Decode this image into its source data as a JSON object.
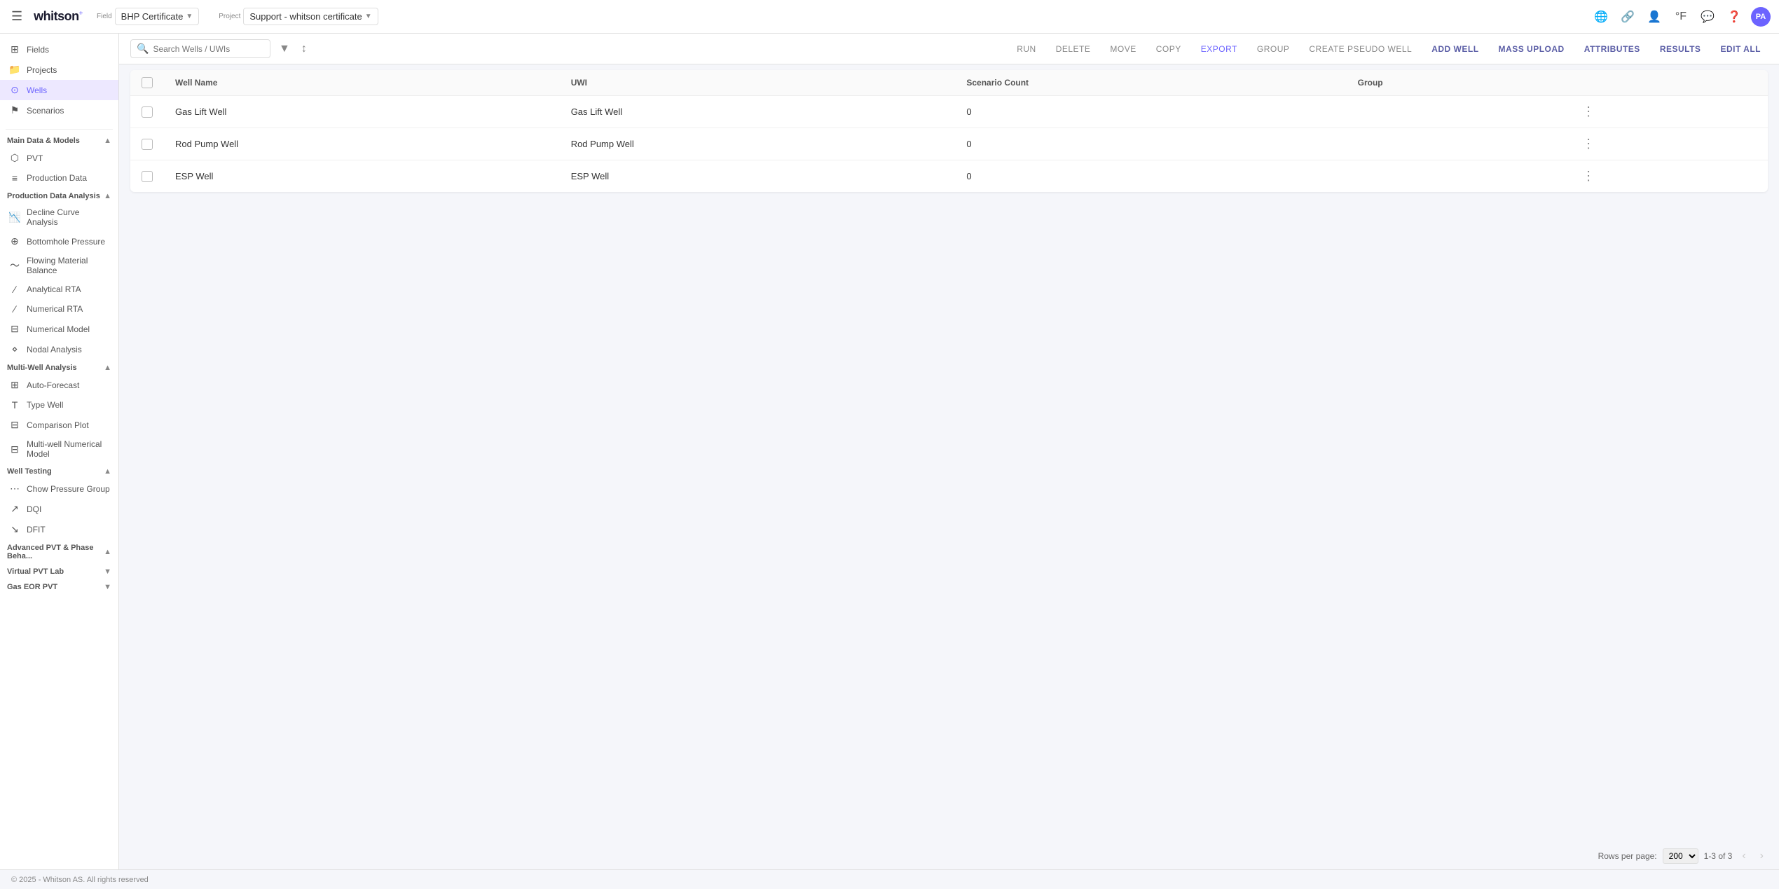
{
  "topbar": {
    "logo": "whitson",
    "logo_sup": "+",
    "field_label": "Field",
    "field_value": "BHP Certificate",
    "project_label": "Project",
    "project_value": "Support - whitson certificate"
  },
  "sidebar": {
    "nav_items": [
      {
        "id": "fields",
        "icon": "⊞",
        "label": "Fields"
      },
      {
        "id": "projects",
        "icon": "📁",
        "label": "Projects"
      },
      {
        "id": "wells",
        "icon": "⊙",
        "label": "Wells",
        "active": true
      },
      {
        "id": "scenarios",
        "icon": "⚑",
        "label": "Scenarios"
      }
    ],
    "sections": [
      {
        "id": "main-data",
        "title": "Main Data & Models",
        "collapsed": false,
        "items": [
          {
            "id": "pvt",
            "icon": "⬡",
            "label": "PVT"
          },
          {
            "id": "production-data",
            "icon": "≡",
            "label": "Production Data"
          }
        ]
      },
      {
        "id": "production-analysis",
        "title": "Production Data Analysis",
        "collapsed": false,
        "items": [
          {
            "id": "decline-curve",
            "icon": "📉",
            "label": "Decline Curve Analysis"
          },
          {
            "id": "bottomhole-pressure",
            "icon": "⊕",
            "label": "Bottomhole Pressure"
          },
          {
            "id": "flowing-material",
            "icon": "〜",
            "label": "Flowing Material Balance"
          },
          {
            "id": "analytical-rta",
            "icon": "⁄",
            "label": "Analytical RTA"
          },
          {
            "id": "numerical-rta",
            "icon": "⁄",
            "label": "Numerical RTA"
          },
          {
            "id": "numerical-model",
            "icon": "⊟",
            "label": "Numerical Model"
          },
          {
            "id": "nodal-analysis",
            "icon": "⋄",
            "label": "Nodal Analysis"
          }
        ]
      },
      {
        "id": "multi-well",
        "title": "Multi-Well Analysis",
        "collapsed": false,
        "items": [
          {
            "id": "auto-forecast",
            "icon": "⊞",
            "label": "Auto-Forecast"
          },
          {
            "id": "type-well",
            "icon": "T",
            "label": "Type Well"
          },
          {
            "id": "comparison-plot",
            "icon": "⊟",
            "label": "Comparison Plot"
          },
          {
            "id": "multi-well-numerical",
            "icon": "⊟",
            "label": "Multi-well Numerical Model"
          }
        ]
      },
      {
        "id": "well-testing",
        "title": "Well Testing",
        "collapsed": false,
        "items": [
          {
            "id": "chow-pressure",
            "icon": "⋯",
            "label": "Chow Pressure Group"
          },
          {
            "id": "dqi",
            "icon": "↗",
            "label": "DQI"
          },
          {
            "id": "dfit",
            "icon": "↘",
            "label": "DFIT"
          }
        ]
      },
      {
        "id": "advanced-pvt",
        "title": "Advanced PVT & Phase Beha...",
        "collapsed": false,
        "items": []
      },
      {
        "id": "virtual-pvt",
        "title": "Virtual PVT Lab",
        "collapsed": true,
        "items": []
      },
      {
        "id": "gas-eor",
        "title": "Gas EOR PVT",
        "collapsed": true,
        "items": []
      }
    ]
  },
  "toolbar": {
    "search_placeholder": "Search Wells / UWIs",
    "buttons": [
      {
        "id": "run",
        "label": "RUN"
      },
      {
        "id": "delete",
        "label": "DELETE"
      },
      {
        "id": "move",
        "label": "MOVE"
      },
      {
        "id": "copy",
        "label": "COPY"
      },
      {
        "id": "export",
        "label": "EXPORT",
        "primary": true
      },
      {
        "id": "group",
        "label": "GROUP"
      },
      {
        "id": "create-pseudo",
        "label": "CREATE PSEUDO WELL"
      },
      {
        "id": "add-well",
        "label": "ADD WELL",
        "bold": true
      },
      {
        "id": "mass-upload",
        "label": "MASS UPLOAD",
        "bold": true
      },
      {
        "id": "attributes",
        "label": "ATTRIBUTES",
        "bold": true
      },
      {
        "id": "results",
        "label": "RESULTS",
        "bold": true
      },
      {
        "id": "edit-all",
        "label": "EDIT ALL",
        "bold": true
      }
    ]
  },
  "table": {
    "columns": [
      {
        "id": "well-name",
        "label": "Well Name"
      },
      {
        "id": "uwi",
        "label": "UWI"
      },
      {
        "id": "scenario-count",
        "label": "Scenario Count"
      },
      {
        "id": "group",
        "label": "Group"
      },
      {
        "id": "actions",
        "label": ""
      }
    ],
    "rows": [
      {
        "id": "gas-lift-well",
        "well_name": "Gas Lift Well",
        "uwi": "Gas Lift Well",
        "scenario_count": "0",
        "group": ""
      },
      {
        "id": "rod-pump-well",
        "well_name": "Rod Pump Well",
        "uwi": "Rod Pump Well",
        "scenario_count": "0",
        "group": ""
      },
      {
        "id": "esp-well",
        "well_name": "ESP Well",
        "uwi": "ESP Well",
        "scenario_count": "0",
        "group": ""
      }
    ]
  },
  "pagination": {
    "rows_per_page_label": "Rows per page:",
    "rows_per_page_value": "200",
    "range": "1-3 of 3"
  },
  "footer": {
    "text": "© 2025 - Whitson AS. All rights reserved"
  }
}
